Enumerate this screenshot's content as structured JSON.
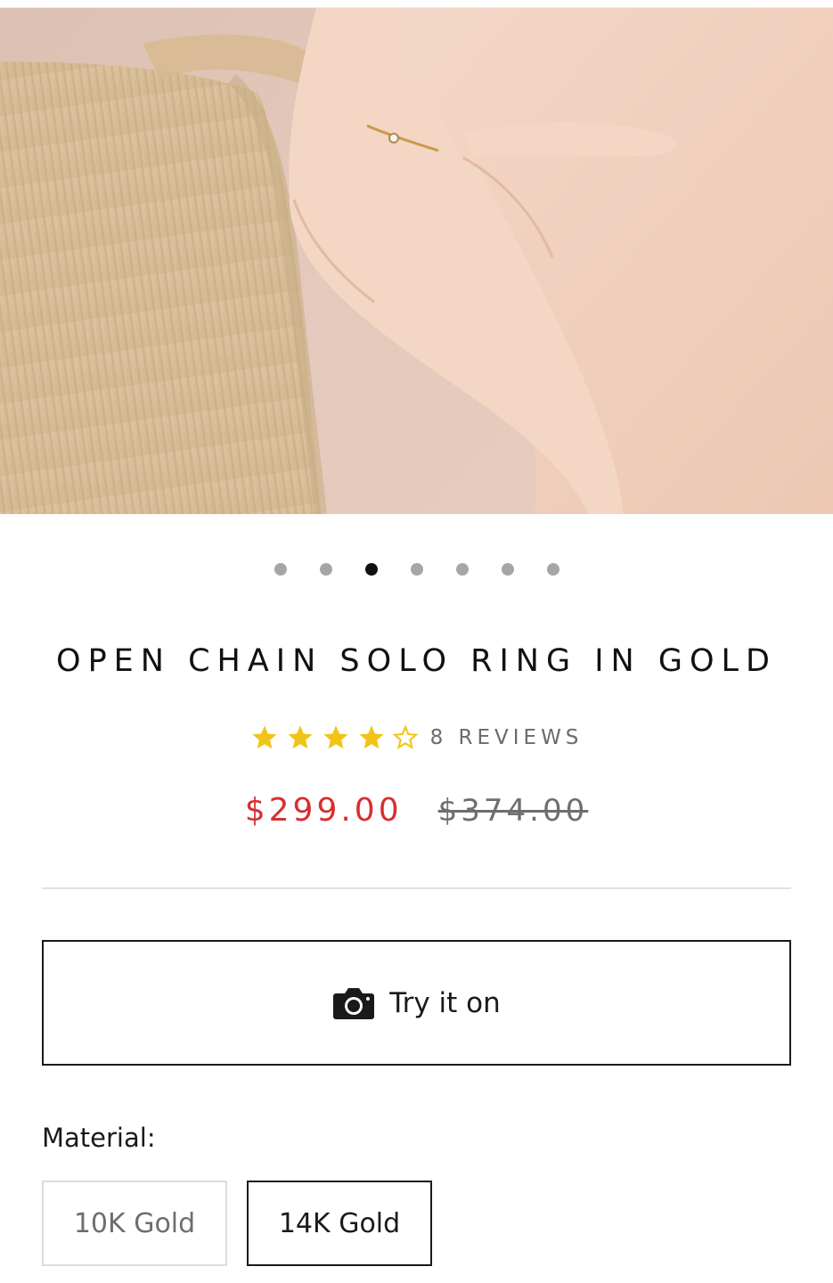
{
  "product": {
    "title": "OPEN CHAIN SOLO RING IN GOLD",
    "rating": 4,
    "rating_max": 5,
    "reviews_label": "8 REVIEWS",
    "price_sale": "$299.00",
    "price_compare": "$374.00"
  },
  "carousel": {
    "total": 7,
    "active_index": 2
  },
  "try_on": {
    "label": "Try it on",
    "icon": "camera-icon"
  },
  "material": {
    "label": "Material:",
    "options": [
      {
        "label": "10K Gold",
        "selected": false
      },
      {
        "label": "14K Gold",
        "selected": true
      }
    ]
  },
  "colors": {
    "sale_price": "#d62f2f",
    "star": "#f2c417",
    "dot_active": "#111111",
    "dot_inactive": "#a6a6a6"
  }
}
